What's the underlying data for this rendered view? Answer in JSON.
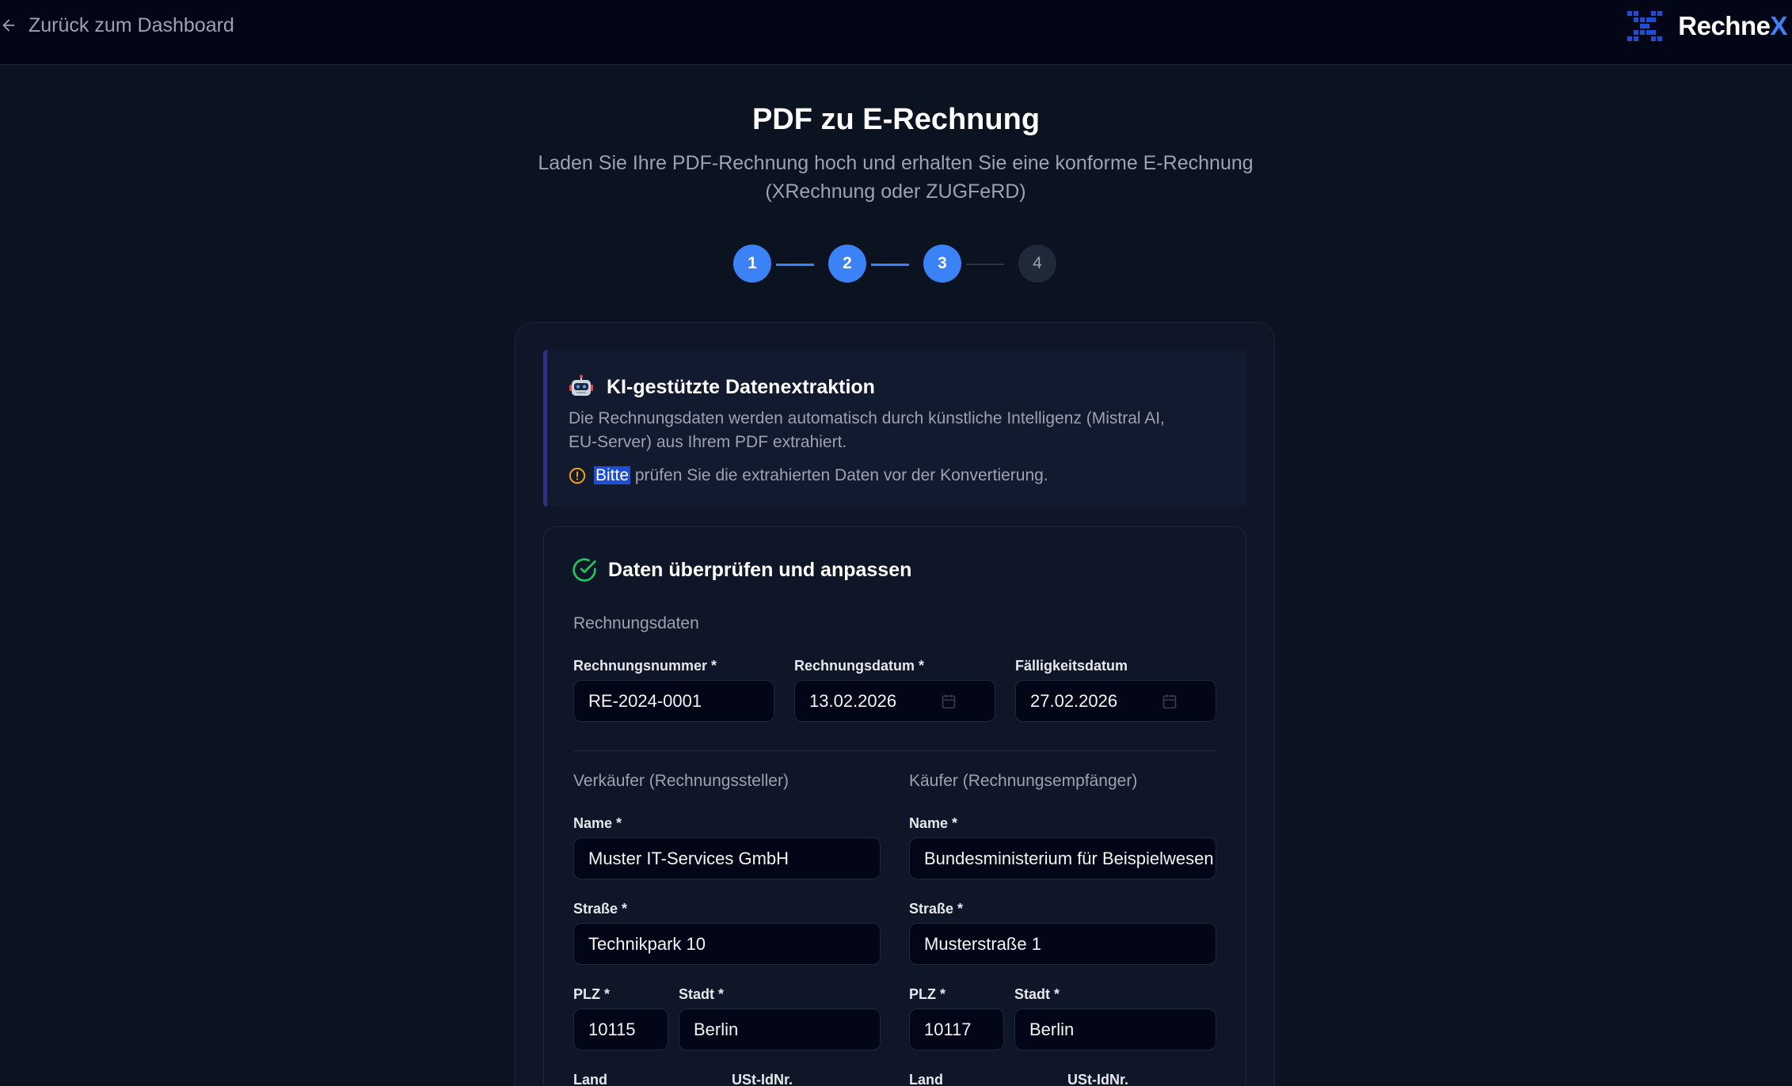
{
  "topbar": {
    "back_label": "Zurück zum Dashboard",
    "brand_main": "Rechne",
    "brand_accent": "X"
  },
  "page": {
    "title": "PDF zu E-Rechnung",
    "subtitle_line1": "Laden Sie Ihre PDF-Rechnung hoch und erhalten Sie eine konforme E-Rechnung",
    "subtitle_line2": "(XRechnung oder ZUGFeRD)"
  },
  "stepper": {
    "steps": [
      "1",
      "2",
      "3",
      "4"
    ],
    "current_step": 3
  },
  "ai_notice": {
    "icon": "robot-icon",
    "title": "KI-gestützte Datenextraktion",
    "text_line1": "Die Rechnungsdaten werden automatisch durch künstliche Intelligenz (Mistral AI,",
    "text_line2": "EU-Server) aus Ihrem PDF extrahiert.",
    "warning_highlight": "Bitte",
    "warning_rest": "prüfen Sie die extrahierten Daten vor der Konvertierung."
  },
  "review": {
    "title": "Daten überprüfen und anpassen",
    "invoice_section": "Rechnungsdaten",
    "invoice_number_label": "Rechnungsnummer *",
    "invoice_number": "RE-2024-0001",
    "invoice_date_label": "Rechnungsdatum *",
    "invoice_date": "13.02.2026",
    "due_date_label": "Fälligkeitsdatum",
    "due_date": "27.02.2026",
    "seller": {
      "section": "Verkäufer (Rechnungssteller)",
      "name_label": "Name *",
      "name": "Muster IT-Services GmbH",
      "street_label": "Straße *",
      "street": "Technikpark 10",
      "zip_label": "PLZ *",
      "zip": "10115",
      "city_label": "Stadt *",
      "city": "Berlin",
      "country_label": "Land",
      "vat_label": "USt-IdNr."
    },
    "buyer": {
      "section": "Käufer (Rechnungsempfänger)",
      "name_label": "Name *",
      "name": "Bundesministerium für Beispielwesen",
      "street_label": "Straße *",
      "street": "Musterstraße 1",
      "zip_label": "PLZ *",
      "zip": "10117",
      "city_label": "Stadt *",
      "city": "Berlin",
      "country_label": "Land",
      "vat_label": "USt-IdNr."
    }
  },
  "colors": {
    "background": "#0b1220",
    "accent": "#3b82f6",
    "success": "#22c55e",
    "warning": "#f59e0b"
  }
}
